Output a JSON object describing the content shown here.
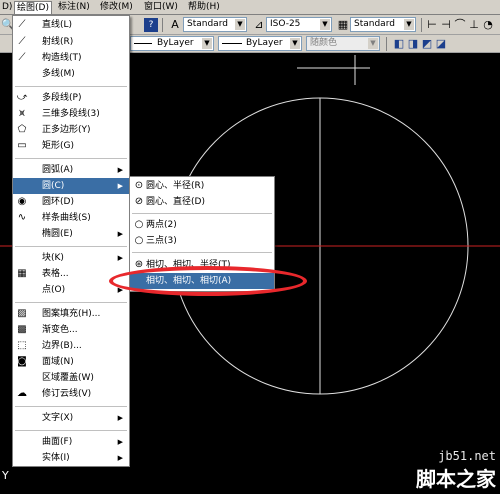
{
  "menubar": {
    "items": [
      {
        "label": "D)"
      },
      {
        "label": "绘图(D)"
      },
      {
        "label": "标注(N)"
      },
      {
        "label": "修改(M)"
      },
      {
        "label": "窗口(W)"
      },
      {
        "label": "帮助(H)"
      }
    ]
  },
  "toolbar": {
    "text_style": "Standard",
    "dim_style": "ISO-25",
    "table_style": "Standard",
    "linetype": "ByLayer",
    "lineweight": "ByLayer",
    "plotstyle": "随颜色"
  },
  "draw_menu": {
    "items": [
      {
        "label": "直线(L)",
        "icon": "line-icon"
      },
      {
        "label": "射线(R)",
        "icon": "ray-icon"
      },
      {
        "label": "构造线(T)",
        "icon": "xline-icon"
      },
      {
        "label": "多线(M)",
        "icon": ""
      },
      {
        "label": "多段线(P)",
        "icon": "polyline-icon"
      },
      {
        "label": "三维多段线(3)",
        "icon": "3dpoly-icon"
      },
      {
        "label": "正多边形(Y)",
        "icon": "polygon-icon"
      },
      {
        "label": "矩形(G)",
        "icon": "rectangle-icon"
      },
      {
        "label": "圆弧(A)",
        "icon": ""
      },
      {
        "label": "圆(C)",
        "icon": ""
      },
      {
        "label": "圆环(D)",
        "icon": "donut-icon"
      },
      {
        "label": "样条曲线(S)",
        "icon": "spline-icon"
      },
      {
        "label": "椭圆(E)",
        "icon": ""
      },
      {
        "label": "块(K)",
        "icon": ""
      },
      {
        "label": "表格...",
        "icon": "table-icon"
      },
      {
        "label": "点(O)",
        "icon": ""
      },
      {
        "label": "图案填充(H)...",
        "icon": "hatch-icon"
      },
      {
        "label": "渐变色...",
        "icon": "gradient-icon"
      },
      {
        "label": "边界(B)...",
        "icon": "boundary-icon"
      },
      {
        "label": "面域(N)",
        "icon": "region-icon"
      },
      {
        "label": "区域覆盖(W)",
        "icon": ""
      },
      {
        "label": "修订云线(V)",
        "icon": "revcloud-icon"
      },
      {
        "label": "文字(X)",
        "icon": ""
      },
      {
        "label": "曲面(F)",
        "icon": ""
      },
      {
        "label": "实体(I)",
        "icon": ""
      }
    ]
  },
  "circle_submenu": {
    "items": [
      {
        "label": "圆心、半径(R)"
      },
      {
        "label": "圆心、直径(D)"
      },
      {
        "label": "两点(2)"
      },
      {
        "label": "三点(3)"
      },
      {
        "label": "相切、相切、半径(T)"
      },
      {
        "label": "相切、相切、相切(A)"
      }
    ]
  },
  "status": {
    "y_axis": "Y"
  },
  "watermark": {
    "url": "jb51.net",
    "name": "脚本之家"
  },
  "colors": {
    "highlight": "#3a6ea5",
    "ring": "#e8282c",
    "crosshair_red": "#cc2222"
  }
}
